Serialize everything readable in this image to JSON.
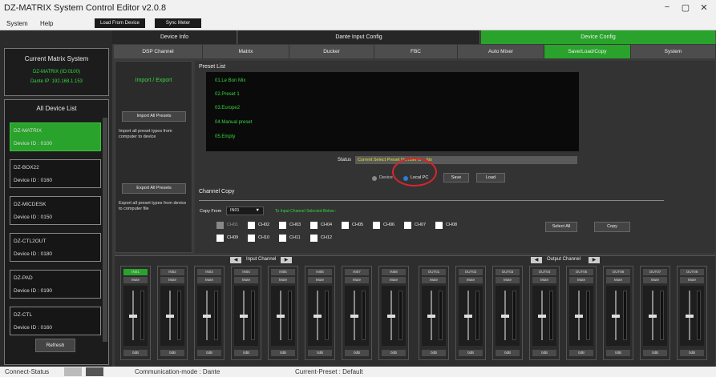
{
  "window": {
    "title": "DZ-MATRIX System Control Editor v2.0.8",
    "minimize": "−",
    "maximize": "▢",
    "close": "✕"
  },
  "menu": {
    "system": "System",
    "help": "Help",
    "load_from_device": "Load From Device",
    "sync_meter": "Sync Meter"
  },
  "top_tabs": [
    {
      "label": "Device Info"
    },
    {
      "label": "Dante Input Config"
    },
    {
      "label": "Device Config"
    }
  ],
  "sub_tabs": [
    {
      "label": "DSP Channel"
    },
    {
      "label": "Matrix"
    },
    {
      "label": "Ducker"
    },
    {
      "label": "FBC"
    },
    {
      "label": "Auto Mixer"
    },
    {
      "label": "Save/Load/Copy"
    },
    {
      "label": "System"
    }
  ],
  "left": {
    "current_header": "Current Matrix System",
    "current_name": "DZ-MATRIX (ID:0100)",
    "current_ip": "Dante IP: 192.168.1.153",
    "list_header": "All Device List",
    "devices": [
      {
        "name": "DZ-MATRIX",
        "id": "Device ID : 0100"
      },
      {
        "name": "DZ-BOX22",
        "id": "Device ID : 0160"
      },
      {
        "name": "DZ-MICDESK",
        "id": "Device ID : 0150"
      },
      {
        "name": "DZ-CTL2OUT",
        "id": "Device ID : 0180"
      },
      {
        "name": "DZ-PAD",
        "id": "Device ID : 0190"
      },
      {
        "name": "DZ-CTL",
        "id": "Device ID : 0160"
      }
    ],
    "refresh": "Refresh"
  },
  "import_export": {
    "title": "Import / Export",
    "import_btn": "Import All Presets",
    "import_desc": "Import all preset types from computer to device",
    "export_btn": "Export All Presets",
    "export_desc": "Export all preset types from device to computer file"
  },
  "preset_list": {
    "title": "Preset List",
    "items": [
      "01.Le Bon Mix",
      "02.Preset 1",
      "03.Europe2",
      "04.Manual preset",
      "05.Empty"
    ],
    "status_label": "Status",
    "status_value": "Current Select Preset Number is -- No",
    "radio_device": "Device",
    "radio_local": "Local PC",
    "save": "Save",
    "load": "Load"
  },
  "channel_copy": {
    "title": "Channel Copy",
    "copy_from_label": "Copy From",
    "copy_from_value": "IN01",
    "to_label": "To Input Channel Selected Below :",
    "channels": [
      "CH01",
      "CH02",
      "CH03",
      "CH04",
      "CH05",
      "CH06",
      "CH07",
      "CH08",
      "CH09",
      "CH10",
      "CH11",
      "CH12"
    ],
    "select_all": "Select All",
    "copy": "Copy"
  },
  "mixer": {
    "input_label": "Input Channel",
    "output_label": "Output Channel",
    "mute": "Mute",
    "db_value": "0dB",
    "inputs": [
      "IN01",
      "IN02",
      "IN03",
      "IN04",
      "IN05",
      "IN06",
      "IN07",
      "IN08"
    ],
    "outputs": [
      "OUT01",
      "OUT02",
      "OUT03",
      "OUT04",
      "OUT05",
      "OUT06",
      "OUT07",
      "OUT08"
    ]
  },
  "statusbar": {
    "connect": "Connect-Status",
    "mode": "Communication-mode : Dante",
    "preset": "Current-Preset : Default"
  },
  "colors": {
    "accent_green": "#29a32b",
    "highlight_red": "#d9262b",
    "status_yellow": "#e3e02a"
  }
}
